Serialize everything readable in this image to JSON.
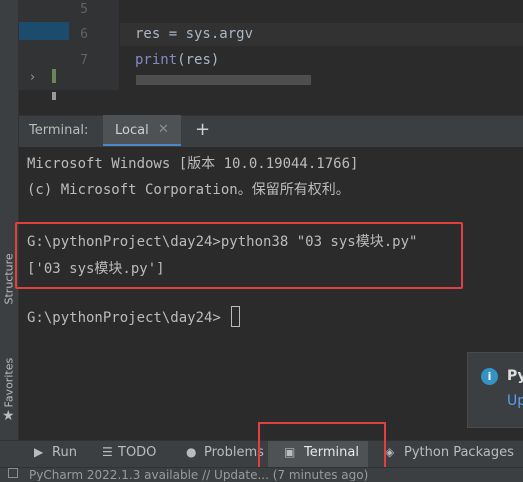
{
  "editor": {
    "line_numbers": [
      "5",
      "6",
      "7"
    ],
    "line6": {
      "code": "res = sys.argv"
    },
    "line7": {
      "func": "print",
      "args": "(res)"
    }
  },
  "side_tabs": {
    "structure": "Structure",
    "favorites": "Favorites"
  },
  "terminal": {
    "title": "Terminal:",
    "tab_label": "Local",
    "close_glyph": "✕",
    "add_glyph": "+",
    "lines": [
      "Microsoft Windows [版本 10.0.19044.1766]",
      "(c) Microsoft Corporation。保留所有权利。",
      "G:\\pythonProject\\day24>python38 \"03 sys模块.py\"",
      "['03 sys模块.py']",
      "G:\\pythonProject\\day24>"
    ]
  },
  "notification": {
    "title": "Py",
    "link": "Up"
  },
  "bottom_tools": {
    "run": "Run",
    "todo": "TODO",
    "problems": "Problems",
    "terminal": "Terminal",
    "python_packages": "Python Packages"
  },
  "status_bar": {
    "text": "PyCharm 2022.1.3 available // Update... (7 minutes ago)"
  },
  "colors": {
    "highlight_box": "#e04040",
    "accent": "#4a88c7",
    "background": "#2b2b2b"
  }
}
